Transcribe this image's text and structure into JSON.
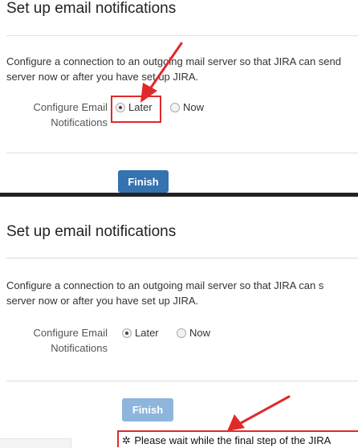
{
  "top": {
    "title": "Set up email notifications",
    "description_line1": "Configure a connection to an outgoing mail server so that JIRA can send",
    "description_line2": "server now or after you have set up JIRA.",
    "label_line1": "Configure Email",
    "label_line2": "Notifications",
    "option_later": "Later",
    "option_now": "Now",
    "selected": "Later",
    "finish_label": "Finish"
  },
  "bottom": {
    "title": "Set up email notifications",
    "description_line1": "Configure a connection to an outgoing mail server so that JIRA can s",
    "description_line2": "server now or after you have set up JIRA.",
    "label_line1": "Configure Email",
    "label_line2": "Notifications",
    "option_later": "Later",
    "option_now": "Now",
    "selected": "Later",
    "finish_label": "Finish",
    "wait_message": "Please wait while the final step of the JIRA"
  },
  "colors": {
    "primary_button": "#3572b0",
    "disabled_button": "#8eb6dc",
    "annotation_red": "#e02a2a"
  },
  "icons": [
    "radio-icon",
    "spinner-icon",
    "annotation-arrow-icon"
  ]
}
